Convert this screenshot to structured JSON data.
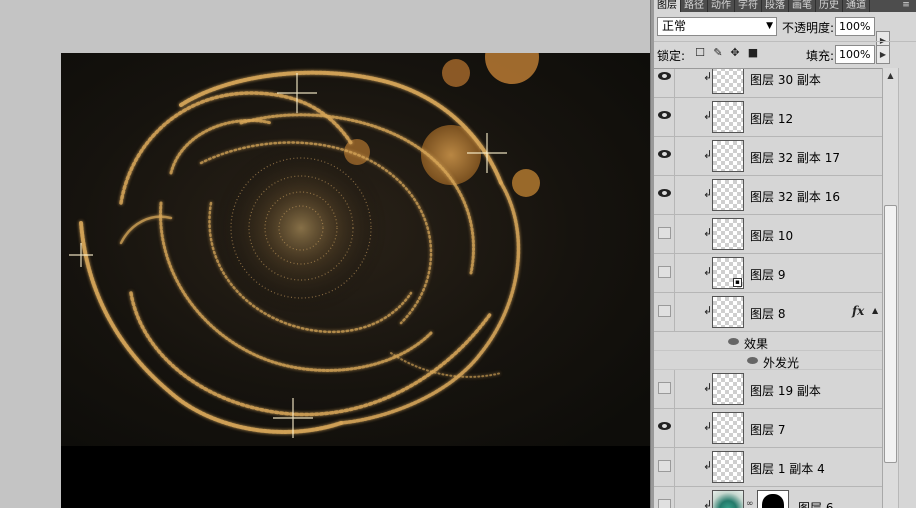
{
  "panel": {
    "tabs": [
      "图层",
      "路径",
      "动作",
      "字符",
      "段落",
      "画笔",
      "历史",
      "通道"
    ],
    "menu_icon": "≡"
  },
  "controls": {
    "blend_mode": "正常",
    "opacity_label": "不透明度:",
    "opacity_value": "100%",
    "lock_label": "锁定:",
    "fill_label": "填充:",
    "fill_value": "100%"
  },
  "layers": [
    {
      "name": "图层 30 副本",
      "visible": true
    },
    {
      "name": "图层 12",
      "visible": true
    },
    {
      "name": "图层 32 副本 17",
      "visible": true
    },
    {
      "name": "图层 32 副本 16",
      "visible": true
    },
    {
      "name": "图层 10",
      "visible": false
    },
    {
      "name": "图层 9",
      "visible": false,
      "smart": true
    },
    {
      "name": "图层 8",
      "visible": false,
      "fx": "fx"
    },
    {
      "name": "图层 19 副本",
      "visible": false
    },
    {
      "name": "图层 7",
      "visible": true
    },
    {
      "name": "图层 1 副本 4",
      "visible": false
    },
    {
      "name": "图层 6",
      "visible": false,
      "mask": true
    }
  ],
  "effects": {
    "group_label": "效果",
    "item_label": "外发光"
  },
  "colors": {
    "gold": "#d9a85a",
    "bokeh": "#b07a36",
    "canvas_bg": "#14120e"
  }
}
